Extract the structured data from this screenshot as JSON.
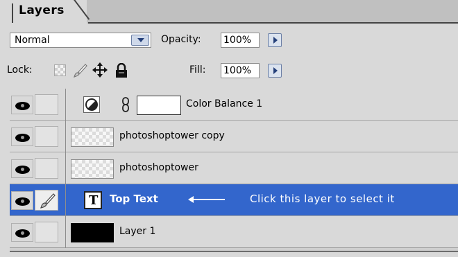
{
  "panel": {
    "tab_label": "Layers"
  },
  "blend": {
    "mode": "Normal",
    "opacity_label": "Opacity:",
    "opacity_value": "100%"
  },
  "lock": {
    "label": "Lock:",
    "fill_label": "Fill:",
    "fill_value": "100%",
    "icons": [
      "lock-transparent-icon",
      "lock-image-brush-icon",
      "lock-position-move-icon",
      "lock-all-padlock-icon"
    ]
  },
  "layers": [
    {
      "name": "Color Balance 1",
      "type": "adjustment",
      "visible": true,
      "selected": false
    },
    {
      "name": "photoshoptower copy",
      "type": "image",
      "visible": true,
      "selected": false
    },
    {
      "name": "photoshoptower",
      "type": "image",
      "visible": true,
      "selected": false
    },
    {
      "name": "Top Text",
      "type": "text",
      "visible": true,
      "selected": true
    },
    {
      "name": "Layer 1",
      "type": "fill",
      "visible": true,
      "selected": false
    }
  ],
  "annotation": {
    "text": "Click this layer to select it"
  },
  "colors": {
    "selection": "#3366cc",
    "panel_bg": "#d9d9d9"
  }
}
